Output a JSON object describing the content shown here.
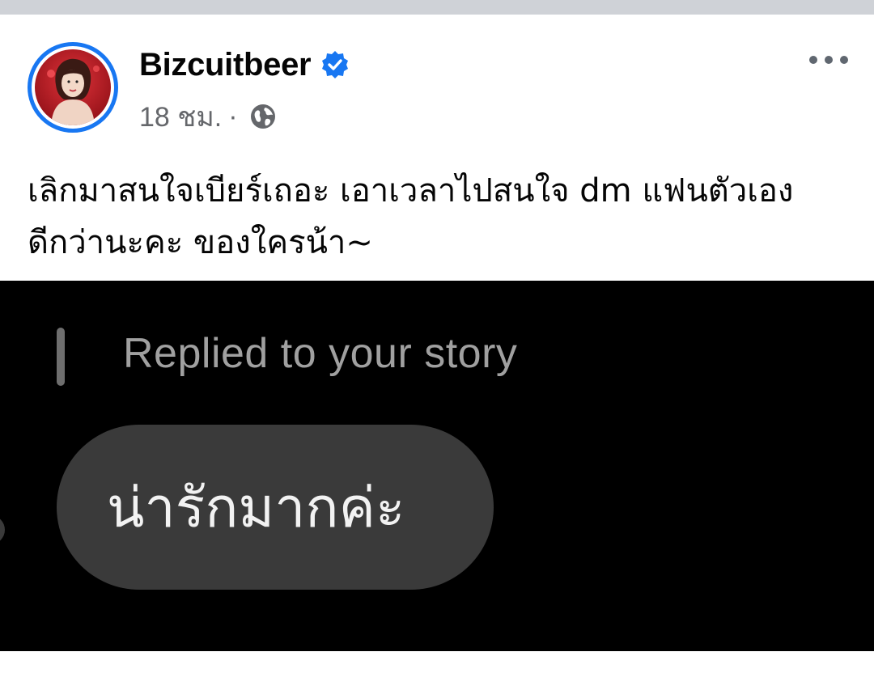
{
  "post": {
    "author": "Bizcuitbeer",
    "verified": true,
    "timestamp": "18 ชม.",
    "separator": "·",
    "audience_icon": "globe-icon",
    "more_icon": "more-options-icon",
    "caption": "เลิกมาสนใจเบียร์เถอะ เอาเวลาไปสนใจ dm แฟนตัวเอง\nดีกว่านะคะ ของใครน้า~"
  },
  "image": {
    "reply_label": "Replied to your story",
    "message": "น่ารักมากค่ะ"
  },
  "colors": {
    "accent": "#1877f2",
    "text": "#050505",
    "secondary_text": "#65676b",
    "photo_bg": "#000000",
    "bubble_bg": "#3a3a3a"
  }
}
